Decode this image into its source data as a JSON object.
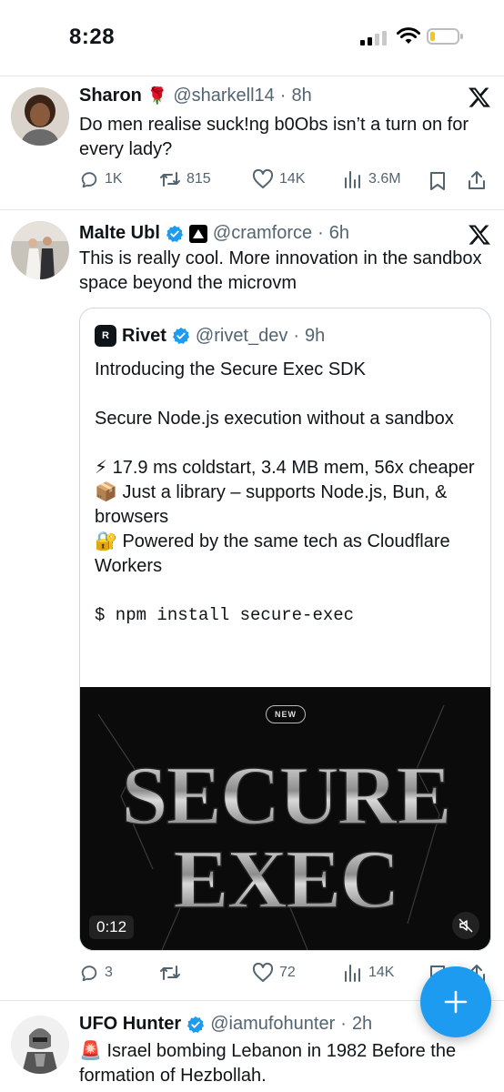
{
  "status_bar": {
    "time": "8:28"
  },
  "tweets": [
    {
      "name": "Sharon",
      "handle": "@sharkell14",
      "time": "8h",
      "text": "Do men realise suck!ng b0Obs isn’t a turn on for every lady?",
      "stats": {
        "replies": "1K",
        "retweets": "815",
        "likes": "14K",
        "views": "3.6M"
      }
    },
    {
      "name": "Malte Ubl",
      "handle": "@cramforce",
      "time": "6h",
      "text": "This is really cool. More innovation in the sandbox space beyond the microvm",
      "quote": {
        "name": "Rivet",
        "handle": "@rivet_dev",
        "time": "9h",
        "logo_text": "R",
        "line1": "Introducing the Secure Exec SDK",
        "line2": "Secure Node.js execution without a sandbox",
        "bullet1": "⚡ 17.9 ms coldstart, 3.4 MB mem, 56x cheaper",
        "bullet2": "📦 Just a library – supports Node.js, Bun, & browsers",
        "bullet3": "🔐 Powered by the same tech as Cloudflare Workers",
        "command": "$ npm install secure-exec",
        "media": {
          "badge": "NEW",
          "title_line1": "SECURE",
          "title_line2": "EXEC",
          "duration": "0:12"
        }
      },
      "stats": {
        "replies": "3",
        "retweets": "",
        "likes": "72",
        "views": "14K"
      }
    },
    {
      "name": "UFO Hunter",
      "handle": "@iamufohunter",
      "time": "2h",
      "text": "🚨 Israel bombing Lebanon in 1982 Before the formation of Hezbollah."
    }
  ],
  "colors": {
    "accent": "#1d9bf0",
    "muted": "#536471",
    "text": "#0f1419"
  }
}
